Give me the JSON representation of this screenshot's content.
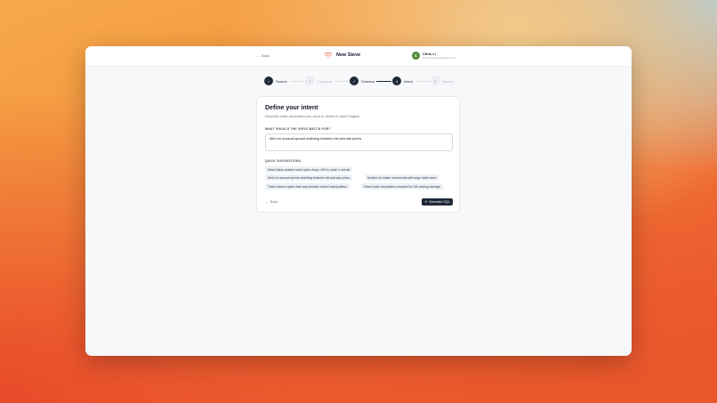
{
  "header": {
    "back_label": "Back",
    "app_title": "New Sieve",
    "user": {
      "initial": "C",
      "name": "Chris Li",
      "email": "chrisli.engineer@gmail.com"
    }
  },
  "steps": [
    {
      "number": "✓",
      "label": "Source",
      "state": "done"
    },
    {
      "number": "2",
      "label": "Configure",
      "state": "todo"
    },
    {
      "number": "✓",
      "label": "Schema",
      "state": "done"
    },
    {
      "number": "4",
      "label": "Intent",
      "state": "active"
    },
    {
      "number": "5",
      "label": "Deploy",
      "state": "todo"
    }
  ],
  "card": {
    "title": "Define your intent",
    "subtitle": "Describe what anomalies you want to detect in plain English",
    "field_label": "WHAT SHOULD THE SIEVE WATCH FOR?",
    "field_value": "Alert on unusual spread widening between bid and ask prices",
    "suggestions_label": "QUICK SUGGESTIONS",
    "suggestions": [
      "Detect flash crashes when price drops >5% in under 1 minute",
      "Alert on unusual spread widening between bid and ask prices",
      "Monitor for whale movements with large trade sizes",
      "Track volume spikes that may indicate market manipulation",
      "Detect price anomalies compared to 24h moving average"
    ],
    "back_label": "Back",
    "generate_label": "Generate SQL"
  },
  "colors": {
    "primary": "#1f2937",
    "avatar": "#4d8b3a",
    "chip_bg": "#eef1f5"
  }
}
